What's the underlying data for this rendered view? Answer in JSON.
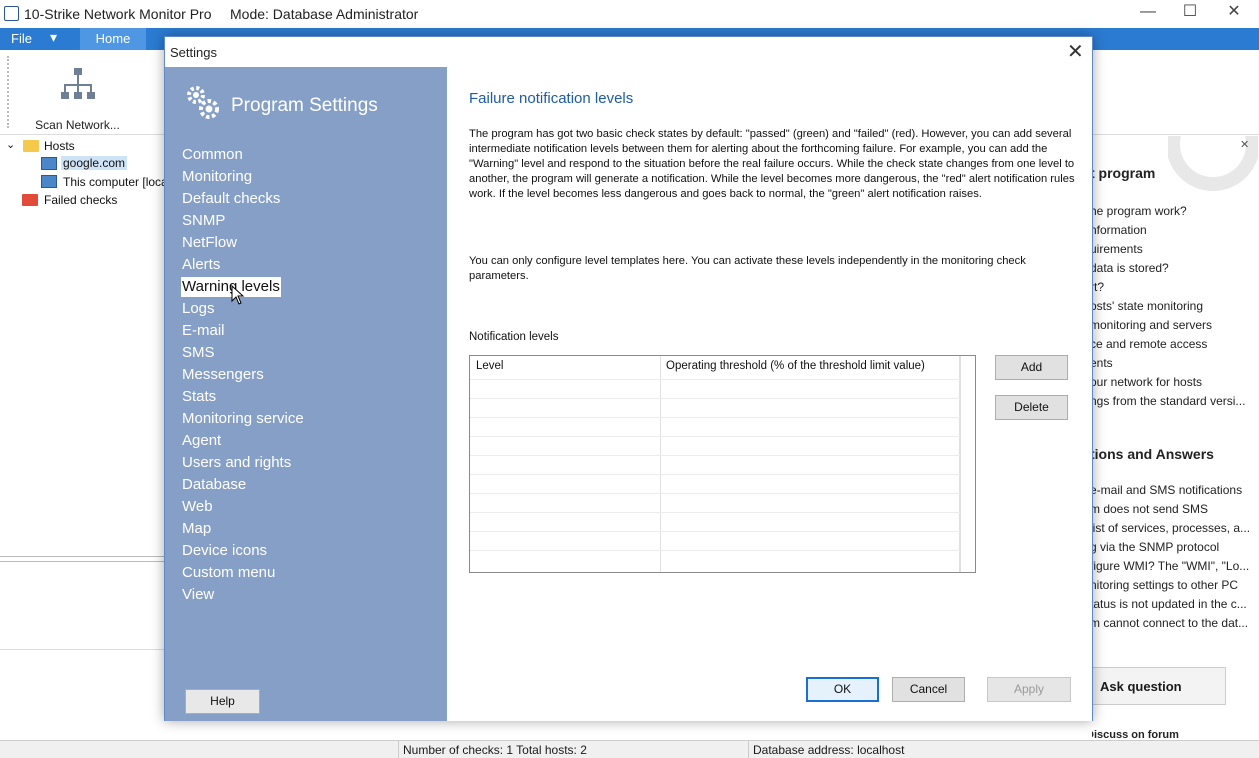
{
  "app": {
    "title": "10-Strike Network Monitor Pro",
    "mode": "Mode: Database Administrator",
    "minimize": "—",
    "maximize": "☐",
    "close": "✕"
  },
  "menubar": {
    "file": "File",
    "file_dropdown": "▾",
    "home": "Home"
  },
  "ribbon": {
    "scan_network": "Scan Network..."
  },
  "tree": {
    "expand": "⌄",
    "hosts": "Hosts",
    "host1": "google.com",
    "host2": "This computer [loca",
    "failed": "Failed checks"
  },
  "statusbar": {
    "checks": "Number of checks: 1  Total hosts: 2",
    "db": "Database address: localhost"
  },
  "right_panel": {
    "section1": "t program",
    "links1": [
      "he program work?",
      "nformation",
      "uirements",
      "data is stored?",
      "rt?",
      "osts' state monitoring",
      "monitoring and servers",
      "ce and remote access",
      "ents",
      "our network for hosts",
      "ngs from the standard versi..."
    ],
    "section2": "tions and Answers",
    "links2": [
      "e-mail and SMS notifications",
      "m does not send SMS",
      " list of services, processes, a...",
      "g via the SNMP protocol",
      "figure WMI? The \"WMI\", \"Lo...",
      "nitoring settings to other PC",
      "tatus is not updated in the c...",
      "m cannot connect to the dat..."
    ],
    "ask": "Ask question",
    "discuss": "Discuss on forum",
    "close": "✕"
  },
  "dialog": {
    "title": "Settings",
    "close": "✕",
    "sidebar_title": "Program Settings",
    "nav": [
      "Common",
      "Monitoring",
      "Default checks",
      "SNMP",
      "NetFlow",
      "Alerts",
      "Warning levels",
      "Logs",
      "E-mail",
      "SMS",
      "Messengers",
      "Stats",
      "Monitoring service",
      "Agent",
      "Users and rights",
      "Database",
      "Web",
      "Map",
      "Device icons",
      "Custom menu",
      "View"
    ],
    "help": "Help",
    "heading": "Failure notification levels",
    "para1": "The program has got two basic check states by default: \"passed\" (green) and \"failed\" (red). However, you can add several intermediate notification levels between them for alerting about the forthcoming failure. For example, you can add the \"Warning\" level and respond to the situation before the real failure occurs. While the check state changes from one level to another, the program will generate a notification. While the level becomes more dangerous, the \"red\" alert notification rules work. If the level becomes less dangerous and goes back to normal, the \"green\" alert notification raises.",
    "para2": "You can only configure level templates here. You can activate these levels independently in the monitoring check parameters.",
    "levels_label": "Notification levels",
    "col_level": "Level",
    "col_threshold": "Operating threshold (% of the threshold limit value)",
    "add": "Add",
    "delete": "Delete",
    "ok": "OK",
    "cancel": "Cancel",
    "apply": "Apply"
  }
}
